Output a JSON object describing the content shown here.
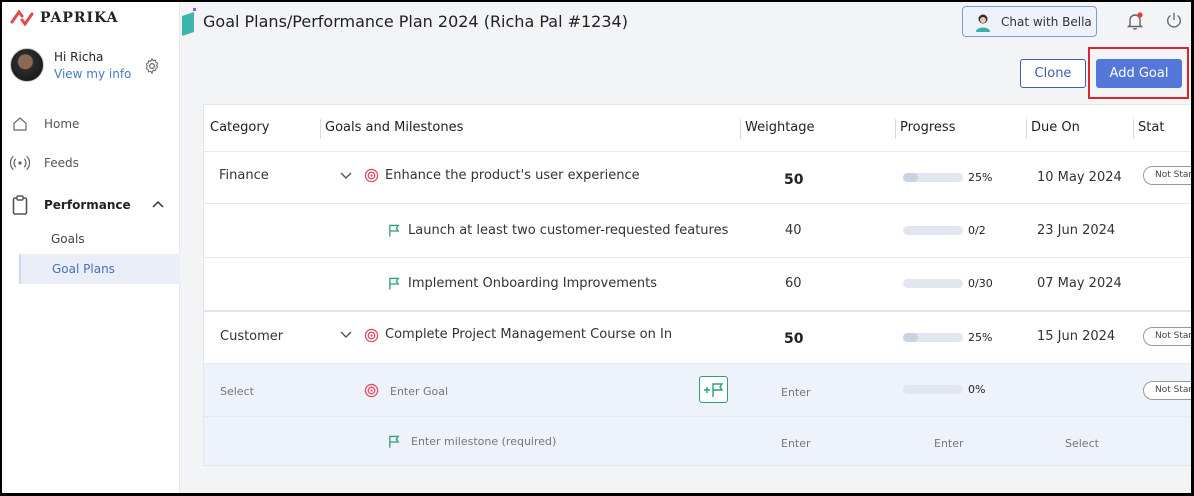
{
  "app": {
    "brand": "PAPRIKA"
  },
  "user": {
    "greeting": "Hi Richa",
    "link": "View my info"
  },
  "nav": {
    "home": "Home",
    "feeds": "Feeds",
    "performance": "Performance",
    "goals": "Goals",
    "goal_plans": "Goal Plans"
  },
  "header": {
    "title": "Goal Plans/Performance Plan 2024 (Richa Pal #1234)",
    "chat": "Chat with Bella"
  },
  "actions": {
    "clone": "Clone",
    "add_goal": "Add Goal"
  },
  "table": {
    "headers": [
      "Category",
      "Goals and Milestones",
      "Weightage",
      "Progress",
      "Due On",
      "Stat"
    ],
    "rows": [
      {
        "category": "Finance",
        "goal": "Enhance the product's user experience",
        "weightage": "50",
        "progress_label": "25%",
        "progress": 0.25,
        "due": "10 May 2024",
        "status": "Not Started"
      },
      {
        "milestone": "Launch at least two customer-requested features",
        "weightage": "40",
        "progress_label": "0/2",
        "progress": 0,
        "due": "23 Jun 2024"
      },
      {
        "milestone": "Implement Onboarding Improvements",
        "weightage": "60",
        "progress_label": "0/30",
        "progress": 0,
        "due": "07 May 2024"
      },
      {
        "category": "Customer",
        "goal": "Complete Project Management Course on In",
        "weightage": "50",
        "progress_label": "25%",
        "progress": 0.25,
        "due": "15 Jun 2024",
        "status": "Not Started"
      }
    ],
    "new_goal": {
      "category_placeholder": "Select",
      "goal_placeholder": "Enter Goal",
      "weightage_placeholder": "Enter",
      "progress_label": "0%",
      "progress": 0,
      "status": "Not Started"
    },
    "new_milestone": {
      "milestone_placeholder": "Enter milestone (required)",
      "weightage_placeholder": "Enter",
      "progress_placeholder": "Enter",
      "due_placeholder": "Select"
    }
  },
  "colors": {
    "accent": "#5577d9",
    "highlight_border": "#d9262c",
    "milestone_icon": "#2aa07a",
    "goal_icon": "#e0506a"
  }
}
